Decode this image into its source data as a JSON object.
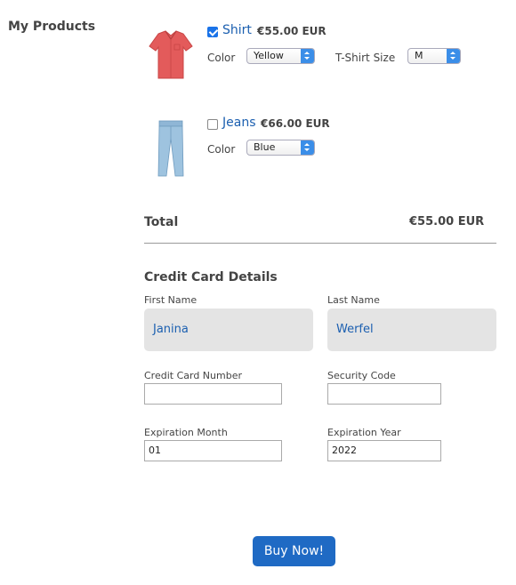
{
  "sidebar": {
    "title": "My Products"
  },
  "products": [
    {
      "name": "Shirt",
      "price": "€55.00 EUR",
      "checked": true,
      "color_label": "Color",
      "color_value": "Yellow",
      "size_label": "T-Shirt Size",
      "size_value": "M",
      "icon": "shirt-icon",
      "image_color": "#e35b5b"
    },
    {
      "name": "Jeans",
      "price": "€66.00 EUR",
      "checked": false,
      "color_label": "Color",
      "color_value": "Blue",
      "icon": "jeans-icon",
      "image_color": "#9ec3df"
    }
  ],
  "total": {
    "label": "Total",
    "value": "€55.00 EUR"
  },
  "credit_card": {
    "title": "Credit Card Details",
    "first_name_label": "First Name",
    "first_name_value": "Janina",
    "last_name_label": "Last Name",
    "last_name_value": "Werfel",
    "card_number_label": "Credit Card Number",
    "card_number_value": "",
    "security_code_label": "Security Code",
    "security_code_value": "",
    "exp_month_label": "Expiration Month",
    "exp_month_value": "01",
    "exp_year_label": "Expiration Year",
    "exp_year_value": "2022"
  },
  "buy_button": {
    "label": "Buy Now!"
  },
  "colors": {
    "accent": "#1f6ac4",
    "link": "#1b5fb0"
  }
}
